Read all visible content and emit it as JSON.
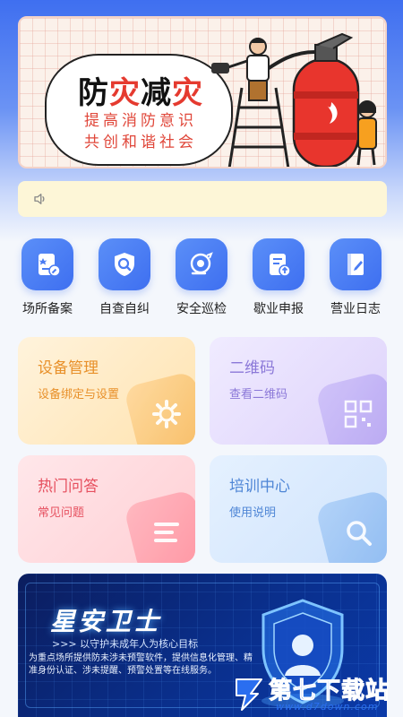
{
  "banner": {
    "title_part1": "防",
    "title_part2": "灾",
    "title_part3": "减",
    "title_part4": "灾",
    "subtitle_line1": "提高消防意识",
    "subtitle_line2": "共创和谐社会"
  },
  "notice": {
    "icon": "speaker-icon",
    "text": ""
  },
  "quick_nav": [
    {
      "label": "场所备案",
      "icon": "file-edit-icon"
    },
    {
      "label": "自查自纠",
      "icon": "shield-search-icon"
    },
    {
      "label": "安全巡检",
      "icon": "patrol-icon"
    },
    {
      "label": "歇业申报",
      "icon": "document-upload-icon"
    },
    {
      "label": "营业日志",
      "icon": "notebook-icon"
    }
  ],
  "cards": {
    "device": {
      "title": "设备管理",
      "subtitle": "设备绑定与设置",
      "icon": "gear-icon"
    },
    "qrcode": {
      "title": "二维码",
      "subtitle": "查看二维码",
      "icon": "qr-code-icon"
    },
    "faq": {
      "title": "热门问答",
      "subtitle": "常见问题",
      "icon": "list-icon"
    },
    "training": {
      "title": "培训中心",
      "subtitle": "使用说明",
      "icon": "search-icon"
    }
  },
  "promo": {
    "title": "星安卫士",
    "slogan": ">>> 以守护未成年人为核心目标",
    "description": "为重点场所提供防未涉未预警软件，提供信息化管理、精准身份认证、涉未提醒、预警处置等在线服务。"
  },
  "watermark": {
    "name": "第七下载站",
    "url": "www.d7down.com"
  }
}
